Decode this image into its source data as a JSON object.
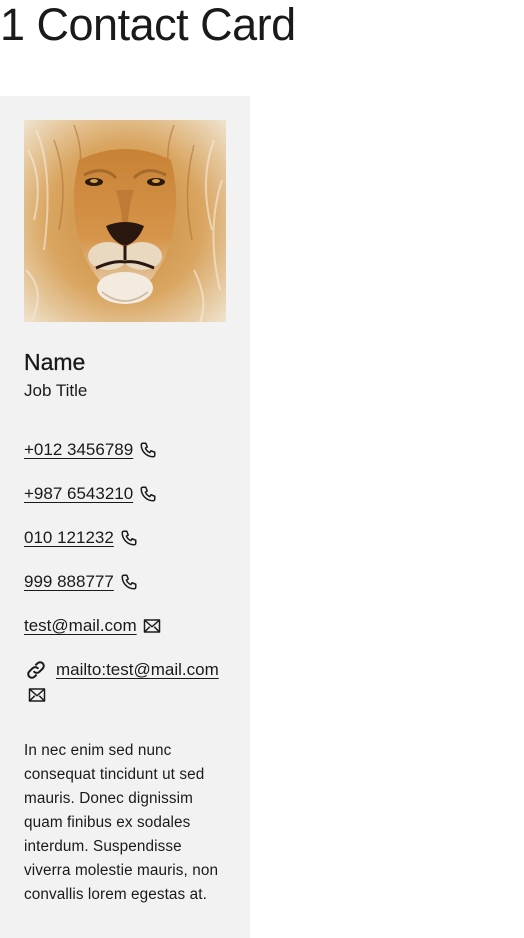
{
  "page": {
    "title": "1 Contact Card"
  },
  "card": {
    "photo": {
      "alt": "Lion",
      "icon": "lion-photo"
    },
    "name": "Name",
    "job_title": "Job Title",
    "contacts": [
      {
        "label": "+012 3456789",
        "icon": "phone-icon"
      },
      {
        "label": "+987 6543210",
        "icon": "phone-icon"
      },
      {
        "label": "010 121232",
        "icon": "phone-icon"
      },
      {
        "label": "999 888777",
        "icon": "phone-icon"
      },
      {
        "label": "test@mail.com",
        "icon": "envelope-icon"
      },
      {
        "label": "mailto:test@mail.com",
        "icon": "link-icon"
      }
    ],
    "bio": "In nec enim sed nunc consequat tincidunt ut sed mauris. Donec dignissim quam finibus ex sodales interdum. Suspendisse viverra molestie mauris, non convallis lorem egestas at."
  },
  "colors": {
    "card_background": "#f2f2f2",
    "text": "#1a1a1a"
  }
}
